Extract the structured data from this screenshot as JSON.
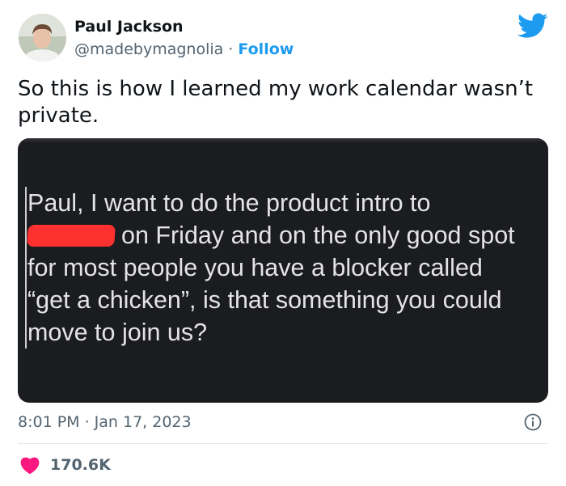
{
  "author": {
    "name": "Paul Jackson",
    "handle": "@madebymagnolia",
    "separator": " · ",
    "follow_label": "Follow"
  },
  "tweet": {
    "text": "So this is how I learned my work calendar wasn’t private."
  },
  "media": {
    "line1": "Paul, I want to do the product intro to",
    "line2": "on Friday and on the only good spot",
    "line3": "for most people you have a blocker called",
    "line4": "“get a chicken”, is that something you could",
    "line5": "move to join us?"
  },
  "meta": {
    "timestamp": "8:01 PM · Jan 17, 2023"
  },
  "engagement": {
    "likes": "170.6K"
  },
  "colors": {
    "accent": "#1d9bf0",
    "like": "#f91880",
    "redaction": "#ff3030"
  },
  "icons": [
    "avatar",
    "twitter-bird-icon",
    "info-icon",
    "heart-icon"
  ]
}
